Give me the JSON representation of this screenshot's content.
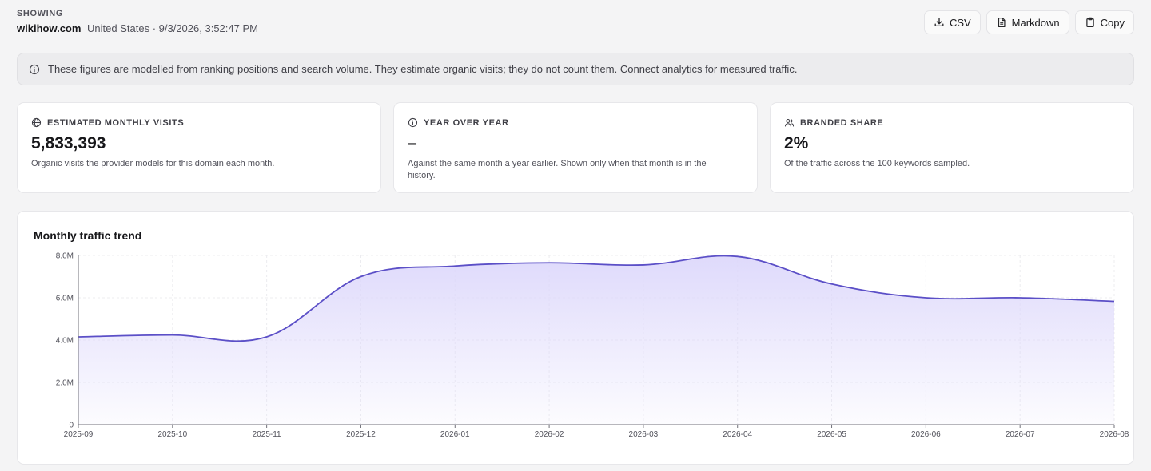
{
  "header": {
    "showing_label": "SHOWING",
    "domain": "wikihow.com",
    "context": "United States · 9/3/2026, 3:52:47 PM"
  },
  "actions": {
    "csv_label": "CSV",
    "markdown_label": "Markdown",
    "copy_label": "Copy"
  },
  "notice": {
    "text": "These figures are modelled from ranking positions and search volume. They estimate organic visits; they do not count them. Connect analytics for measured traffic."
  },
  "cards": [
    {
      "icon": "globe-icon",
      "label": "ESTIMATED MONTHLY VISITS",
      "value": "5,833,393",
      "desc": "Organic visits the provider models for this domain each month."
    },
    {
      "icon": "info-icon",
      "label": "YEAR OVER YEAR",
      "value": "–",
      "desc": "Against the same month a year earlier. Shown only when that month is in the history."
    },
    {
      "icon": "users-icon",
      "label": "BRANDED SHARE",
      "value": "2%",
      "desc": "Of the traffic across the 100 keywords sampled."
    }
  ],
  "chart": {
    "title": "Monthly traffic trend"
  },
  "chart_data": {
    "type": "area",
    "title": "Monthly traffic trend",
    "x": [
      "2025-09",
      "2025-10",
      "2025-11",
      "2025-12",
      "2026-01",
      "2026-02",
      "2026-03",
      "2026-04",
      "2026-05",
      "2026-06",
      "2026-07",
      "2026-08"
    ],
    "values": [
      4150000,
      4240000,
      4150000,
      7000000,
      7500000,
      7650000,
      7550000,
      7950000,
      6650000,
      6000000,
      6000000,
      5830000
    ],
    "ylim": [
      0,
      8000000
    ],
    "yticks": [
      0,
      2000000,
      4000000,
      6000000,
      8000000
    ],
    "ytick_labels": [
      "0",
      "2.0M",
      "4.0M",
      "6.0M",
      "8.0M"
    ],
    "grid": true,
    "line_color": "#5b4fc7",
    "fill_color": "#ddd8fb"
  }
}
